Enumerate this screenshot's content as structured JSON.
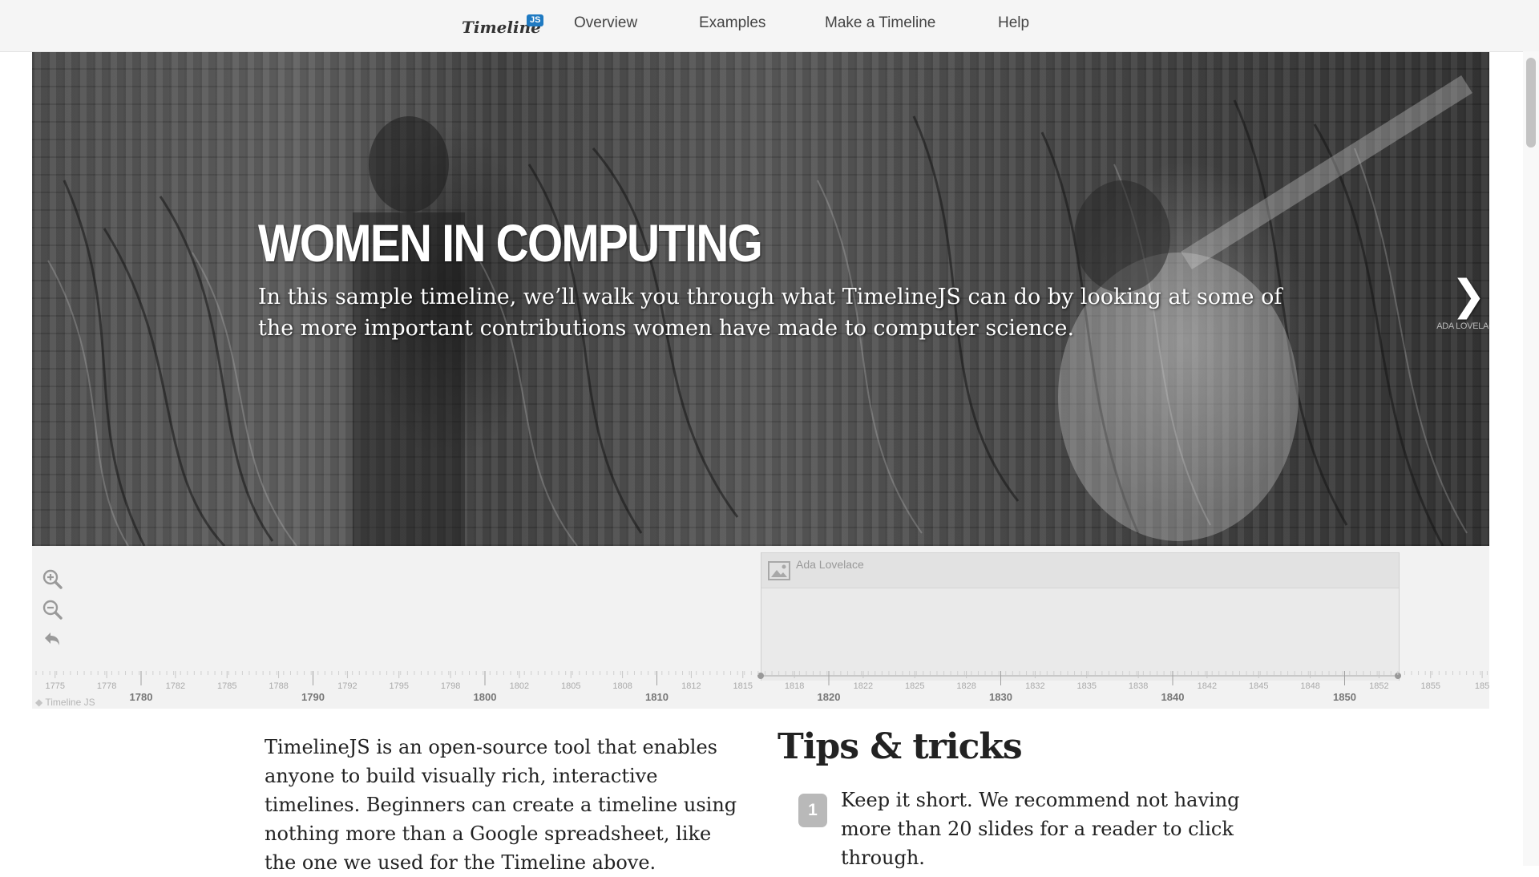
{
  "nav": {
    "brand": "Timeline",
    "brand_badge": "JS",
    "links": [
      "Overview",
      "Examples",
      "Make a Timeline",
      "Help"
    ]
  },
  "slide": {
    "title": "WOMEN IN COMPUTING",
    "text": "In this sample timeline, we’ll walk you through what TimelineJS can do by looking at some of the more important contributions women have made to computer science.",
    "next_label": "ADA LOVELACE",
    "next_icon": "chevron-right-icon"
  },
  "timenav": {
    "zoom_controls": [
      "zoom-in-icon",
      "zoom-out-icon",
      "back-to-start-icon"
    ],
    "marker": {
      "title": "Ada Lovelace",
      "icon": "image-icon"
    },
    "era_start_year": 1815,
    "era_end_year": 1852,
    "major_ticks": [
      "1780",
      "1790",
      "1800",
      "1810",
      "1820",
      "1830",
      "1840",
      "1850"
    ],
    "minor_ticks": [
      "1775",
      "1778",
      "1782",
      "1785",
      "1788",
      "1792",
      "1795",
      "1798",
      "1802",
      "1805",
      "1808",
      "1812",
      "1815",
      "1818",
      "1822",
      "1825",
      "1828",
      "1832",
      "1835",
      "1838",
      "1842",
      "1845",
      "1848",
      "1852",
      "1855",
      "185"
    ],
    "credit": "Timeline JS"
  },
  "content": {
    "intro": "TimelineJS is an open-source tool that enables anyone to build visually rich, interactive timelines. Beginners can create a timeline using nothing more than a Google spreadsheet, like the one we used for the Timeline above.",
    "tips_heading": "Tips & tricks",
    "tips": [
      {
        "num": "1",
        "text": "Keep it short. We recommend not having more than 20 slides for a reader to click through."
      }
    ]
  },
  "colors": {
    "navbar_bg": "#f5f5f5",
    "badge": "#1f7ac2",
    "timenav_bg": "#f2f2f2",
    "tip_badge": "#b9b9b9"
  }
}
